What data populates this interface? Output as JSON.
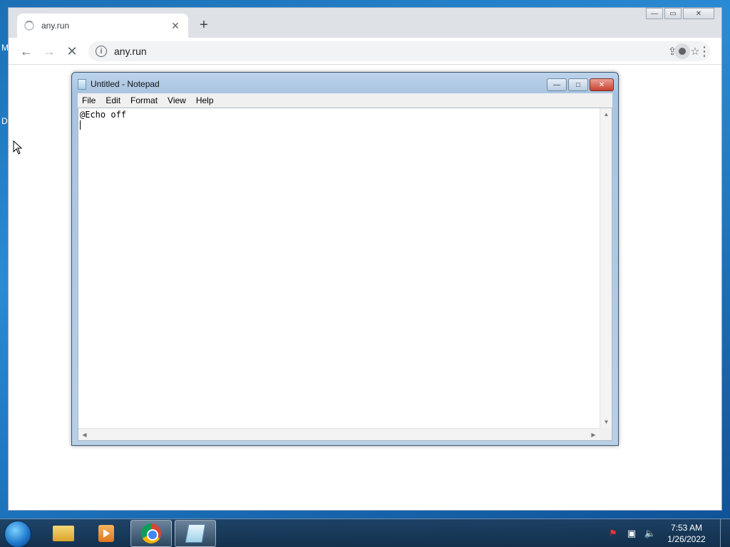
{
  "desktop": {
    "frag_top": "M",
    "frag_mid": "D"
  },
  "browser": {
    "tab_title": "any.run",
    "tab_close": "✕",
    "new_tab": "+",
    "window_controls": {
      "minimize": "—",
      "restore": "▭",
      "close": "✕"
    },
    "nav": {
      "back": "←",
      "forward": "→",
      "stop": "✕"
    },
    "url": "any.run",
    "info_glyph": "i",
    "share_glyph": "⇪",
    "star_glyph": "☆",
    "menu_glyph": "⋮"
  },
  "notepad": {
    "title": "Untitled - Notepad",
    "controls": {
      "minimize": "—",
      "maximize": "□",
      "close": "✕"
    },
    "menu": [
      "File",
      "Edit",
      "Format",
      "View",
      "Help"
    ],
    "content": "@Echo off",
    "scroll": {
      "up": "▲",
      "down": "▼",
      "left": "◀",
      "right": "▶"
    }
  },
  "taskbar": {
    "clock_time": "7:53 AM",
    "clock_date": "1/26/2022",
    "tray_icons": [
      "flag-icon",
      "network-icon",
      "volume-icon"
    ],
    "tray_glyphs": [
      "⚑",
      "▣",
      "🔈"
    ]
  },
  "colors": {
    "desktop_blue": "#1b6fb5",
    "chrome_tabstrip": "#dee1e6",
    "notepad_frame": "#bcd3eb",
    "notepad_close": "#c8412d"
  }
}
